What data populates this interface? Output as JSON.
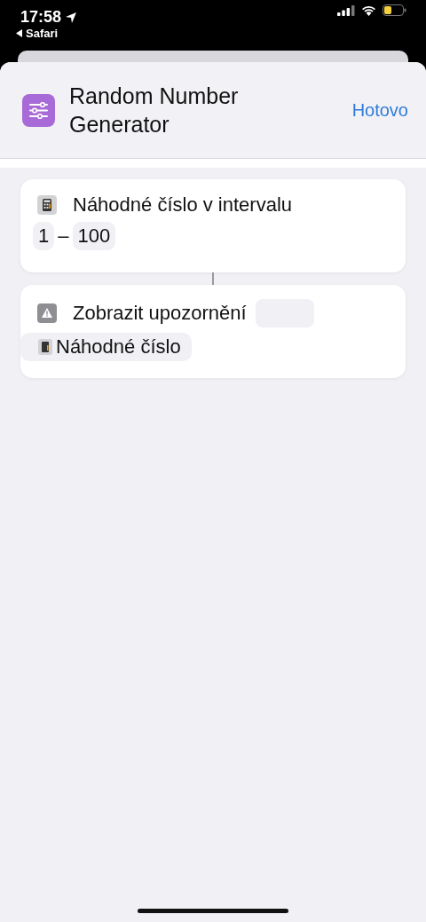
{
  "status_bar": {
    "time": "17:58",
    "back_label": "Safari"
  },
  "header": {
    "title": "Random Number Generator",
    "done": "Hotovo"
  },
  "actions": [
    {
      "kind": "random",
      "title": "Náhodné číslo v intervalu",
      "min": "1",
      "separator": "–",
      "max": "100"
    },
    {
      "kind": "alert",
      "title": "Zobrazit upozornění",
      "variable": "Náhodné číslo"
    }
  ]
}
